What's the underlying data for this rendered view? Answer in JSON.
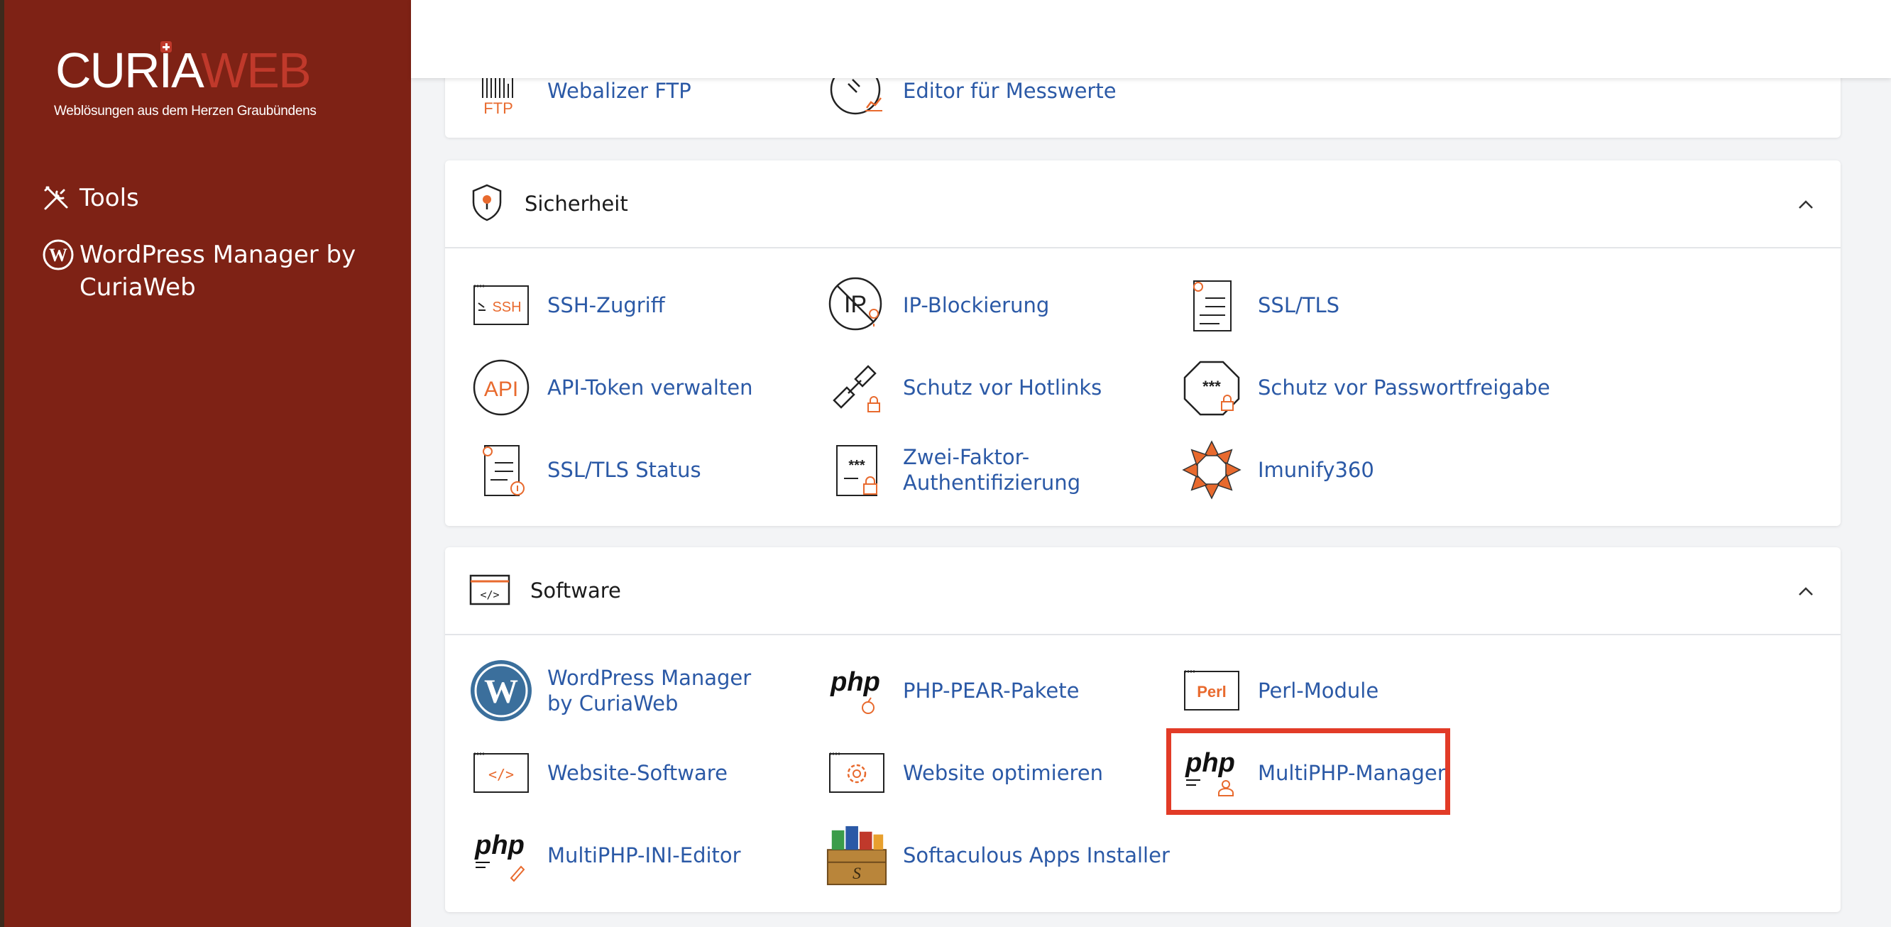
{
  "brand": {
    "logo_part1": "CURIA",
    "logo_part2": "WEB",
    "tagline": "Weblösungen aus dem Herzen Graubündens"
  },
  "sidebar": {
    "items": [
      {
        "label": "Tools",
        "icon": "tools-icon"
      },
      {
        "label": "WordPress Manager by CuriaWeb",
        "icon": "wordpress-icon"
      }
    ]
  },
  "top_partial": {
    "items": [
      {
        "label": "Webalizer FTP",
        "icon": "ftp-icon"
      },
      {
        "label": "Editor für Messwerte",
        "icon": "metrics-editor-icon"
      }
    ]
  },
  "security": {
    "title": "Sicherheit",
    "items": [
      {
        "label": "SSH-Zugriff",
        "icon": "ssh-icon"
      },
      {
        "label": "IP-Blockierung",
        "icon": "ip-block-icon"
      },
      {
        "label": "SSL/TLS",
        "icon": "ssl-certificate-icon"
      },
      {
        "label": "API-Token verwalten",
        "icon": "api-icon"
      },
      {
        "label": "Schutz vor Hotlinks",
        "icon": "hotlink-icon"
      },
      {
        "label": "Schutz vor Passwortfreigabe",
        "icon": "password-protect-icon"
      },
      {
        "label": "SSL/TLS Status",
        "icon": "ssl-status-icon"
      },
      {
        "label": "Zwei-Faktor-Authentifizierung",
        "icon": "two-factor-icon"
      },
      {
        "label": "Imunify360",
        "icon": "imunify-icon"
      }
    ]
  },
  "software": {
    "title": "Software",
    "items": [
      {
        "label": "WordPress Manager by CuriaWeb",
        "icon": "wordpress-icon"
      },
      {
        "label": "PHP-PEAR-Pakete",
        "icon": "php-pear-icon"
      },
      {
        "label": "Perl-Module",
        "icon": "perl-icon"
      },
      {
        "label": "Website-Software",
        "icon": "code-window-icon"
      },
      {
        "label": "Website optimieren",
        "icon": "optimize-icon"
      },
      {
        "label": "MultiPHP-Manager",
        "icon": "php-manager-icon"
      },
      {
        "label": "MultiPHP-INI-Editor",
        "icon": "php-ini-icon"
      },
      {
        "label": "Softaculous Apps Installer",
        "icon": "softaculous-icon"
      }
    ],
    "perl_badge": "Perl",
    "php_text": "php"
  },
  "colors": {
    "sidebar": "#7e2215",
    "link": "#2b59a6",
    "accent": "#e86a2e",
    "highlight": "#e23b27"
  }
}
